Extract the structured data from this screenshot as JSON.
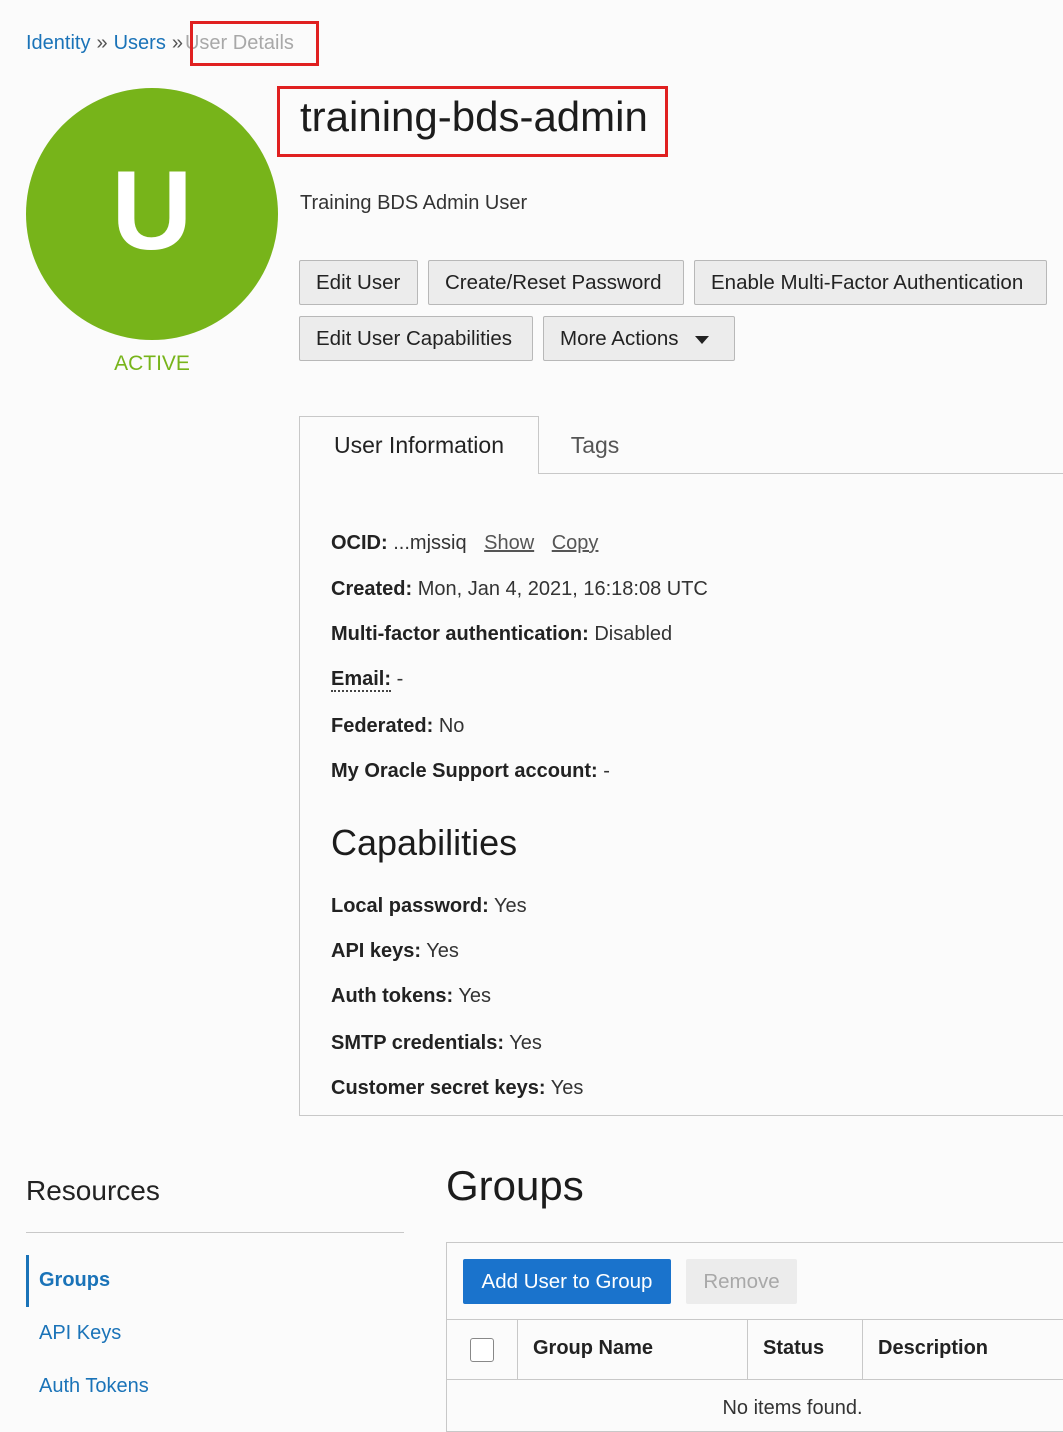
{
  "breadcrumb": {
    "items": [
      {
        "label": "Identity"
      },
      {
        "label": "Users"
      }
    ],
    "separator": "»",
    "current": "User Details"
  },
  "avatar": {
    "letter": "U",
    "color": "#77b41a",
    "status": "ACTIVE"
  },
  "user": {
    "name": "training-bds-admin",
    "description": "Training BDS Admin User"
  },
  "actions": {
    "edit_user": "Edit User",
    "reset_password": "Create/Reset Password",
    "enable_mfa": "Enable Multi-Factor Authentication",
    "edit_capabilities": "Edit User Capabilities",
    "more_actions": "More Actions"
  },
  "tabs": {
    "user_information": "User Information",
    "tags": "Tags"
  },
  "info": {
    "ocid_label": "OCID:",
    "ocid_value": "...mjssiq",
    "show_link": "Show",
    "copy_link": "Copy",
    "created_label": "Created:",
    "created_value": "Mon, Jan 4, 2021, 16:18:08 UTC",
    "mfa_label": "Multi-factor authentication:",
    "mfa_value": "Disabled",
    "email_label": "Email:",
    "email_value": "-",
    "federated_label": "Federated:",
    "federated_value": "No",
    "mos_label": "My Oracle Support account:",
    "mos_value": "-"
  },
  "capabilities": {
    "heading": "Capabilities",
    "local_password_label": "Local password:",
    "local_password_value": "Yes",
    "api_keys_label": "API keys:",
    "api_keys_value": "Yes",
    "auth_tokens_label": "Auth tokens:",
    "auth_tokens_value": "Yes",
    "smtp_label": "SMTP credentials:",
    "smtp_value": "Yes",
    "secret_keys_label": "Customer secret keys:",
    "secret_keys_value": "Yes"
  },
  "resources": {
    "title": "Resources",
    "items": [
      {
        "label": "Groups",
        "active": true
      },
      {
        "label": "API Keys",
        "active": false
      },
      {
        "label": "Auth Tokens",
        "active": false
      }
    ]
  },
  "groups": {
    "title": "Groups",
    "add_button": "Add User to Group",
    "remove_button": "Remove",
    "columns": [
      "Group Name",
      "Status",
      "Description"
    ],
    "empty_message": "No items found."
  },
  "colors": {
    "link": "#1a73b8",
    "primary": "#1a73cc",
    "active": "#77b41a",
    "highlight": "#e02020"
  }
}
